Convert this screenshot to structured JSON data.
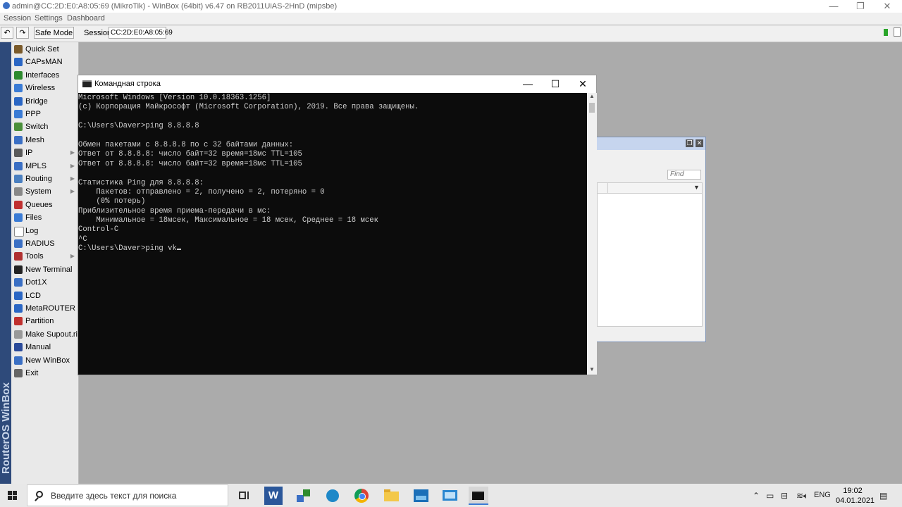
{
  "winbox": {
    "title": "admin@CC:2D:E0:A8:05:69 (MikroTik) - WinBox (64bit) v6.47 on RB2011UiAS-2HnD (mipsbe)",
    "menu": [
      "Session",
      "Settings",
      "Dashboard"
    ],
    "toolbar": {
      "safe_mode": "Safe Mode",
      "session_label": "Session:",
      "session_value": "CC:2D:E0:A8:05:69"
    },
    "brand": "RouterOS WinBox",
    "sidebar": [
      {
        "label": "Quick Set",
        "icon": "quick-set-icon",
        "color": "#7a5a2a",
        "arrow": false
      },
      {
        "label": "CAPsMAN",
        "icon": "capsman-icon",
        "color": "#2a66c4",
        "arrow": false
      },
      {
        "label": "Interfaces",
        "icon": "interfaces-icon",
        "color": "#2e8b2e",
        "arrow": false
      },
      {
        "label": "Wireless",
        "icon": "wireless-icon",
        "color": "#3a7bd5",
        "arrow": false
      },
      {
        "label": "Bridge",
        "icon": "bridge-icon",
        "color": "#2a66c4",
        "arrow": false
      },
      {
        "label": "PPP",
        "icon": "ppp-icon",
        "color": "#3a7bd5",
        "arrow": false
      },
      {
        "label": "Switch",
        "icon": "switch-icon",
        "color": "#4a8f3a",
        "arrow": false
      },
      {
        "label": "Mesh",
        "icon": "mesh-icon",
        "color": "#3a6fc4",
        "arrow": false
      },
      {
        "label": "IP",
        "icon": "ip-icon",
        "color": "#5a5a5a",
        "arrow": true
      },
      {
        "label": "MPLS",
        "icon": "mpls-icon",
        "color": "#3a6fc4",
        "arrow": true
      },
      {
        "label": "Routing",
        "icon": "routing-icon",
        "color": "#4a7fc0",
        "arrow": true
      },
      {
        "label": "System",
        "icon": "system-icon",
        "color": "#888888",
        "arrow": true
      },
      {
        "label": "Queues",
        "icon": "queues-icon",
        "color": "#c03030",
        "arrow": false
      },
      {
        "label": "Files",
        "icon": "files-icon",
        "color": "#3a7bd5",
        "arrow": false
      },
      {
        "label": "Log",
        "icon": "log-icon",
        "color": "#ffffff",
        "arrow": false
      },
      {
        "label": "RADIUS",
        "icon": "radius-icon",
        "color": "#3a6fc4",
        "arrow": false
      },
      {
        "label": "Tools",
        "icon": "tools-icon",
        "color": "#b03030",
        "arrow": true
      },
      {
        "label": "New Terminal",
        "icon": "terminal-icon",
        "color": "#222222",
        "arrow": false
      },
      {
        "label": "Dot1X",
        "icon": "dot1x-icon",
        "color": "#3a6fc4",
        "arrow": false
      },
      {
        "label": "LCD",
        "icon": "lcd-icon",
        "color": "#2a66c4",
        "arrow": false
      },
      {
        "label": "MetaROUTER",
        "icon": "metarouter-icon",
        "color": "#2a66c4",
        "arrow": false
      },
      {
        "label": "Partition",
        "icon": "partition-icon",
        "color": "#c0302e",
        "arrow": false
      },
      {
        "label": "Make Supout.rif",
        "icon": "supout-icon",
        "color": "#999999",
        "arrow": false
      },
      {
        "label": "Manual",
        "icon": "manual-icon",
        "color": "#2a4a9a",
        "arrow": false
      },
      {
        "label": "New WinBox",
        "icon": "new-winbox-icon",
        "color": "#3a6fc4",
        "arrow": false
      },
      {
        "label": "Exit",
        "icon": "exit-icon",
        "color": "#666666",
        "arrow": false
      }
    ],
    "bg_window": {
      "find_placeholder": "Find"
    }
  },
  "cmd": {
    "title": "Командная строка",
    "lines": [
      "Microsoft Windows [Version 10.0.18363.1256]",
      "(c) Корпорация Майкрософт (Microsoft Corporation), 2019. Все права защищены.",
      "",
      "C:\\Users\\Daver>ping 8.8.8.8",
      "",
      "Обмен пакетами с 8.8.8.8 по с 32 байтами данных:",
      "Ответ от 8.8.8.8: число байт=32 время=18мс TTL=105",
      "Ответ от 8.8.8.8: число байт=32 время=18мс TTL=105",
      "",
      "Статистика Ping для 8.8.8.8:",
      "    Пакетов: отправлено = 2, получено = 2, потеряно = 0",
      "    (0% потерь)",
      "Приблизительное время приема-передачи в мс:",
      "    Минимальное = 18мсек, Максимальное = 18 мсек, Среднее = 18 мсек",
      "Control-C",
      "^C"
    ],
    "current_input": "C:\\Users\\Daver>ping vk"
  },
  "taskbar": {
    "search_placeholder": "Введите здесь текст для поиска",
    "language": "ENG",
    "time": "19:02",
    "date": "04.01.2021"
  }
}
